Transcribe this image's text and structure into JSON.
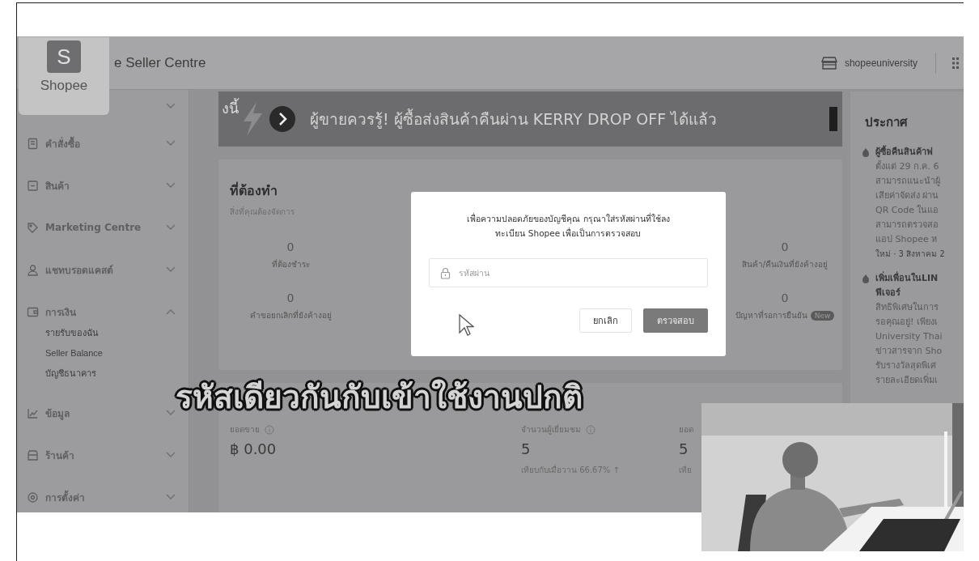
{
  "logo_badge": {
    "mark": "S",
    "name": "Shopee"
  },
  "top_bar": {
    "title": "e Seller Centre",
    "shop_name": "shopeeuniversity"
  },
  "sidebar": {
    "items": [
      {
        "expanded": false
      },
      {
        "label": "คำสั่งซื้อ",
        "expanded": false
      },
      {
        "label": "สินค้า",
        "expanded": false
      },
      {
        "label": "Marketing Centre",
        "expanded": false
      },
      {
        "label": "แชทบรอดแคสต์",
        "expanded": false
      },
      {
        "label": "การเงิน",
        "expanded": true,
        "children": [
          {
            "label": "รายรับของฉัน"
          },
          {
            "label": "Seller Balance"
          },
          {
            "label": "บัญชีธนาคาร"
          }
        ]
      },
      {
        "label": "ข้อมูล",
        "expanded": false
      },
      {
        "label": "ร้านค้า",
        "expanded": false
      },
      {
        "label": "การตั้งค่า",
        "expanded": false
      }
    ]
  },
  "banner": {
    "cut_text": "งนี้",
    "message": "ผู้ขายควรรู้! ผู้ซื้อส่งสินค้าคืนผ่าน KERRY DROP OFF ได้แล้ว"
  },
  "todo": {
    "title": "ที่ต้องทำ",
    "subtitle": "สิ่งที่คุณต้องจัดการ",
    "stats": [
      {
        "value": "0",
        "label": "ที่ต้องชำระ"
      },
      {
        "value": "0",
        "label": "สินค้า/คืนเงินที่ยังค้างอยู่"
      },
      {
        "value": "0",
        "label": "คำขอยกเลิกที่ยังค้างอยู่"
      },
      {
        "value": "0",
        "label": "ปัญหาที่รอการยืนยัน",
        "badge": "New"
      }
    ]
  },
  "metrics": [
    {
      "label": "ยอดขาย",
      "info": true,
      "value": "฿ 0.00"
    },
    {
      "label": "จำนวนผู้เยี่ยมชม",
      "info": true,
      "value": "5",
      "comparison": "เทียบกับเมื่อวาน 66.67% ↑"
    },
    {
      "label": "ยอด",
      "info": false,
      "value": "5",
      "comparison": "เทีย"
    }
  ],
  "announcements": {
    "title": "ประกาศ",
    "items": [
      {
        "title_lines": [
          "ผู้ซื้อคืนสินค้าฟ"
        ],
        "body_lines": [
          "ตั้งแต่ 29 ก.ค. 6",
          "สามารถแนะนำผู้",
          "เสียค่าจัดส่ง ผ่าน",
          "QR Code ในแอ",
          "สามารถตรวจสอ",
          "แอป Shopee ห"
        ],
        "date": "ใหม่ · 3 สิงหาคม 2"
      },
      {
        "title_lines": [
          "เพิ่มเพื่อนในLIN",
          "ฟีเจอร์"
        ],
        "body_lines": [
          "สิทธิพิเศษในการ",
          "รอคุณอยู่! เพียงเ",
          "University Thai",
          "ข่าวสารจาก Sho",
          "รับรางวัลสุดพิเศ",
          "รายละเอียดเพิ่มเ"
        ]
      }
    ]
  },
  "modal": {
    "message_lines": [
      "เพื่อความปลอดภัยของบัญชีคุณ กรุณาใส่รหัสผ่านที่ใช้ลง",
      "ทะเบียน Shopee เพื่อเป็นการตรวจสอบ"
    ],
    "password_placeholder": "รหัสผ่าน",
    "buttons": [
      {
        "label": "ยกเลิก",
        "kind": "secondary"
      },
      {
        "label": "ตรวจสอบ",
        "kind": "primary"
      }
    ]
  },
  "caption": "รหัสเดียวกันกับเข้าใช้งานปกติ"
}
